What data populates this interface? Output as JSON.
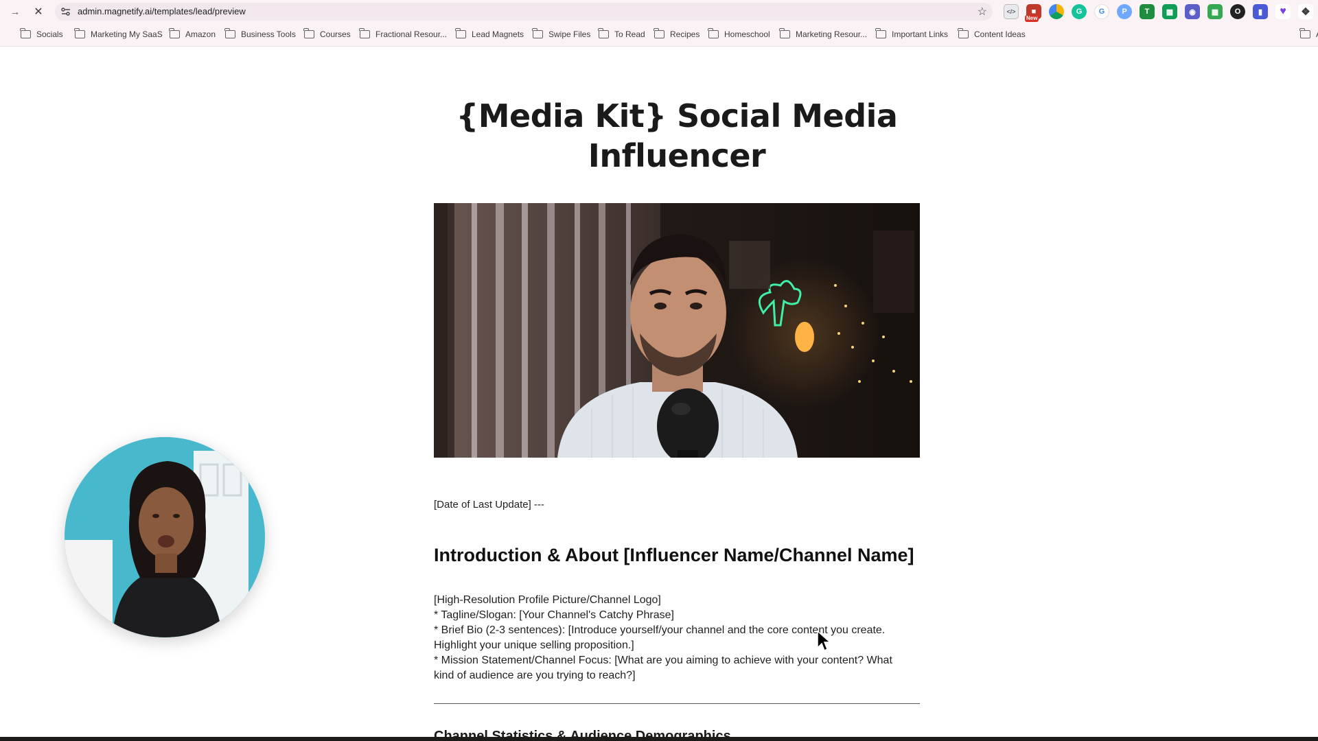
{
  "browser": {
    "url": "admin.magnetify.ai/templates/lead/preview",
    "extension_new_badge": "New",
    "bookmarks": [
      {
        "label": "Socials"
      },
      {
        "label": "Marketing My SaaS"
      },
      {
        "label": "Amazon"
      },
      {
        "label": "Business Tools"
      },
      {
        "label": "Courses"
      },
      {
        "label": "Fractional Resour..."
      },
      {
        "label": "Lead Magnets"
      },
      {
        "label": "Swipe Files"
      },
      {
        "label": "To Read"
      },
      {
        "label": "Recipes"
      },
      {
        "label": "Homeschool"
      },
      {
        "label": "Marketing Resour..."
      },
      {
        "label": "Important Links"
      },
      {
        "label": "Content Ideas"
      },
      {
        "label": "A"
      }
    ]
  },
  "page": {
    "title_line1": "{Media Kit} Social Media",
    "title_line2": "Influencer",
    "date_line": "[Date of Last Update] ---",
    "intro_heading": "Introduction & About [Influencer Name/Channel Name]",
    "intro_lines": [
      "[High-Resolution Profile Picture/Channel Logo]",
      "* Tagline/Slogan: [Your Channel's Catchy Phrase]",
      "* Brief Bio (2-3 sentences): [Introduce yourself/your channel and the core content you create.",
      "Highlight your unique selling proposition.]",
      "* Mission Statement/Channel Focus: [What are you aiming to achieve with your content? What",
      "kind of audience are you trying to reach?]"
    ],
    "next_heading": "Channel Statistics & Audience Demographics"
  },
  "icons": {
    "back": "arrow-left-icon",
    "stop": "close-icon",
    "site_info": "tune-icon",
    "bookmark_star": "star-icon",
    "folder": "folder-icon"
  }
}
